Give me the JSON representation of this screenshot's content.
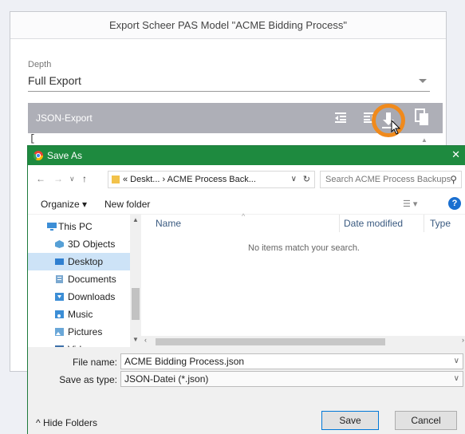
{
  "export_dialog": {
    "title": "Export Scheer PAS Model \"ACME Bidding Process\"",
    "depth_label": "Depth",
    "depth_value": "Full Export",
    "json_export_label": "JSON-Export",
    "json_preview": "["
  },
  "save_as": {
    "title": "Save As",
    "address": "« Deskt... › ACME Process Back...",
    "search_placeholder": "Search ACME Process Backups",
    "toolbar": {
      "organize": "Organize ▾",
      "new_folder": "New folder",
      "help": "?"
    },
    "nav_items": [
      {
        "label": "This PC",
        "icon": "computer-icon"
      },
      {
        "label": "3D Objects",
        "icon": "cube-icon"
      },
      {
        "label": "Desktop",
        "icon": "desktop-icon",
        "selected": true
      },
      {
        "label": "Documents",
        "icon": "document-icon"
      },
      {
        "label": "Downloads",
        "icon": "download-icon"
      },
      {
        "label": "Music",
        "icon": "music-icon"
      },
      {
        "label": "Pictures",
        "icon": "pictures-icon"
      },
      {
        "label": "Videos",
        "icon": "video-icon"
      }
    ],
    "columns": [
      "Name",
      "Date modified",
      "Type"
    ],
    "empty_message": "No items match your search.",
    "file_name_label": "File name:",
    "file_name_value": "ACME Bidding Process.json",
    "save_type_label": "Save as type:",
    "save_type_value": "JSON-Datei (*.json)",
    "hide_folders": "Hide Folders",
    "save_button": "Save",
    "cancel_button": "Cancel"
  },
  "colors": {
    "titlebar": "#1e8a3f",
    "json_header": "#aeafb7",
    "highlight": "#f08a1c",
    "selected_item": "#cde3f7"
  }
}
